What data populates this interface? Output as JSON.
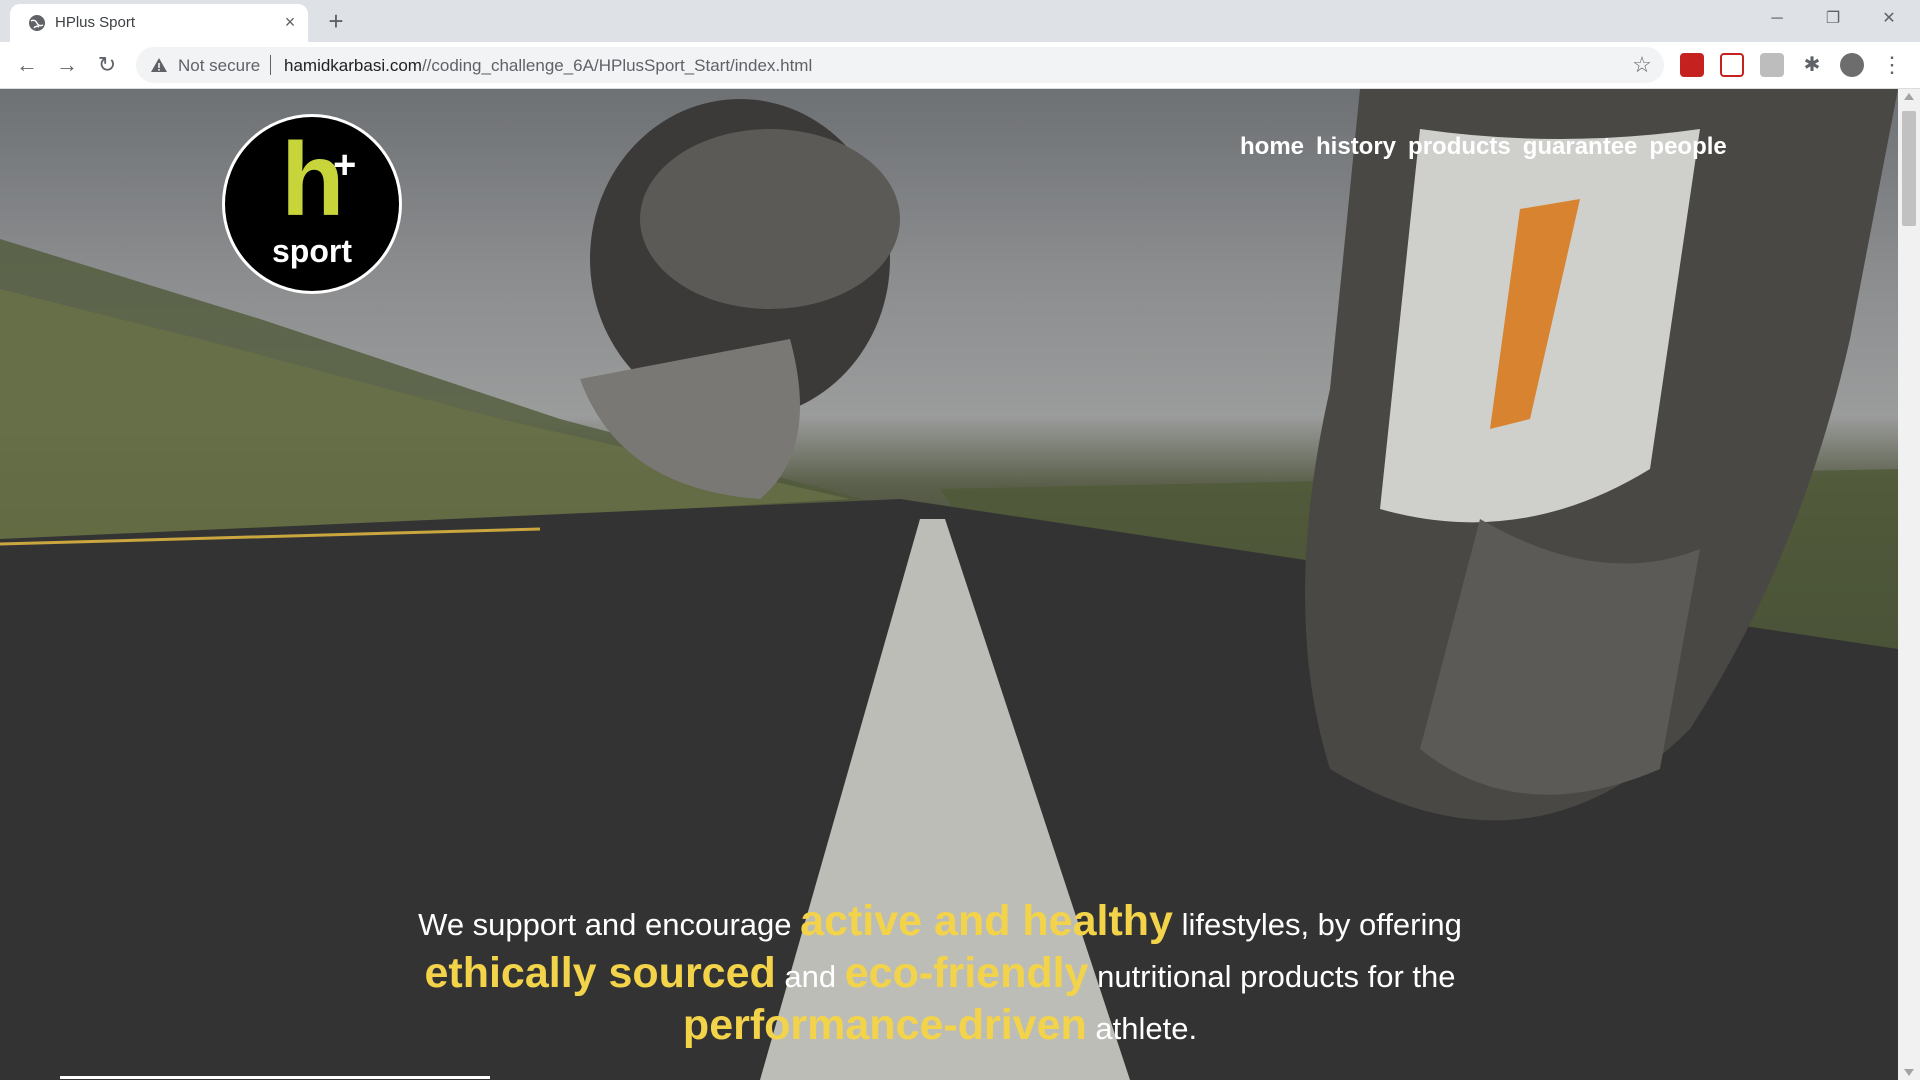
{
  "browser": {
    "tab_title": "HPlus Sport",
    "tab_close": "×",
    "new_tab": "+",
    "window_controls": [
      "─",
      "❐",
      "✕"
    ],
    "security_label": "Not secure",
    "url_host": "hamidkarbasi.com",
    "url_path": "//coding_challenge_6A/HPlusSport_Start/index.html",
    "nav_back": "←",
    "nav_forward": "→",
    "nav_reload": "↻",
    "bookmark_star": "☆",
    "menu": "⋮"
  },
  "site": {
    "logo_h": "h",
    "logo_plus": "+",
    "logo_word": "sport",
    "nav": [
      "home",
      "history",
      "products",
      "guarantee",
      "people"
    ],
    "tagline": {
      "p1": "We support and encourage ",
      "h1": "active and healthy",
      "p2": " lifestyles, by offering ",
      "h2": "ethically sourced",
      "p3": " and ",
      "h3": "eco-friendly",
      "p4": " nutritional products for the ",
      "h4": "performance-driven",
      "p5": " athlete."
    }
  },
  "colors": {
    "accent_yellow": "#f3d349",
    "logo_green": "#c8d53a"
  }
}
